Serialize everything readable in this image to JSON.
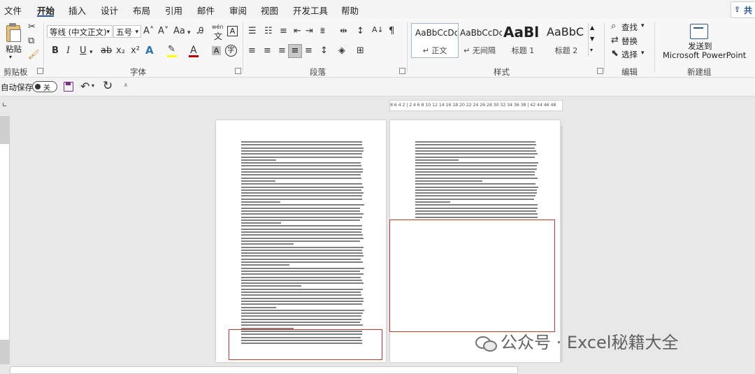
{
  "menu": {
    "items": [
      "文件",
      "开始",
      "插入",
      "设计",
      "布局",
      "引用",
      "邮件",
      "审阅",
      "视图",
      "开发工具",
      "帮助"
    ],
    "active": "开始",
    "share": "共"
  },
  "ribbon": {
    "clipboard": {
      "paste": "粘贴",
      "label": "剪贴板"
    },
    "font": {
      "family": "等线 (中文正文)",
      "size": "五号",
      "label": "字体",
      "wen": "wén",
      "bold": "B",
      "italic": "I",
      "underline": "U",
      "strike": "ab",
      "sub": "x₂",
      "sup": "x²",
      "grow": "A˄",
      "shrink": "A˅",
      "case": "Aa",
      "clear": "A",
      "border": "A",
      "effect": "A",
      "highlight": "A",
      "color": "A",
      "shade": "A",
      "circle": "字",
      "accent_color": "#c00000",
      "highlight_color": "#ffff00"
    },
    "paragraph": {
      "label": "段落"
    },
    "styles": {
      "label": "样式",
      "items": [
        {
          "preview": "AaBbCcDc",
          "name": "↵ 正文"
        },
        {
          "preview": "AaBbCcDc",
          "name": "↵ 无间隔"
        },
        {
          "preview": "AaBl",
          "name": "标题 1"
        },
        {
          "preview": "AaBbC",
          "name": "标题 2"
        }
      ]
    },
    "editing": {
      "find": "查找",
      "replace": "替换",
      "select": "选择",
      "label": "编辑"
    },
    "newgroup": {
      "send_line1": "发送到",
      "send_line2": "Microsoft PowerPoint",
      "label": "新建组"
    }
  },
  "qat": {
    "autosave": "自动保存",
    "toggle": "关"
  },
  "ruler": {
    "text": "8 6 4 2 | 2 4 6 8 10 12 14 16 18 20 22 24 26 28 30 32 34 36 38 | 42 44 46 48"
  },
  "watermark": "公众号 · Excel秘籍大全",
  "colors": {
    "accent": "#2b579a",
    "highlight_box": "#c0392b"
  }
}
